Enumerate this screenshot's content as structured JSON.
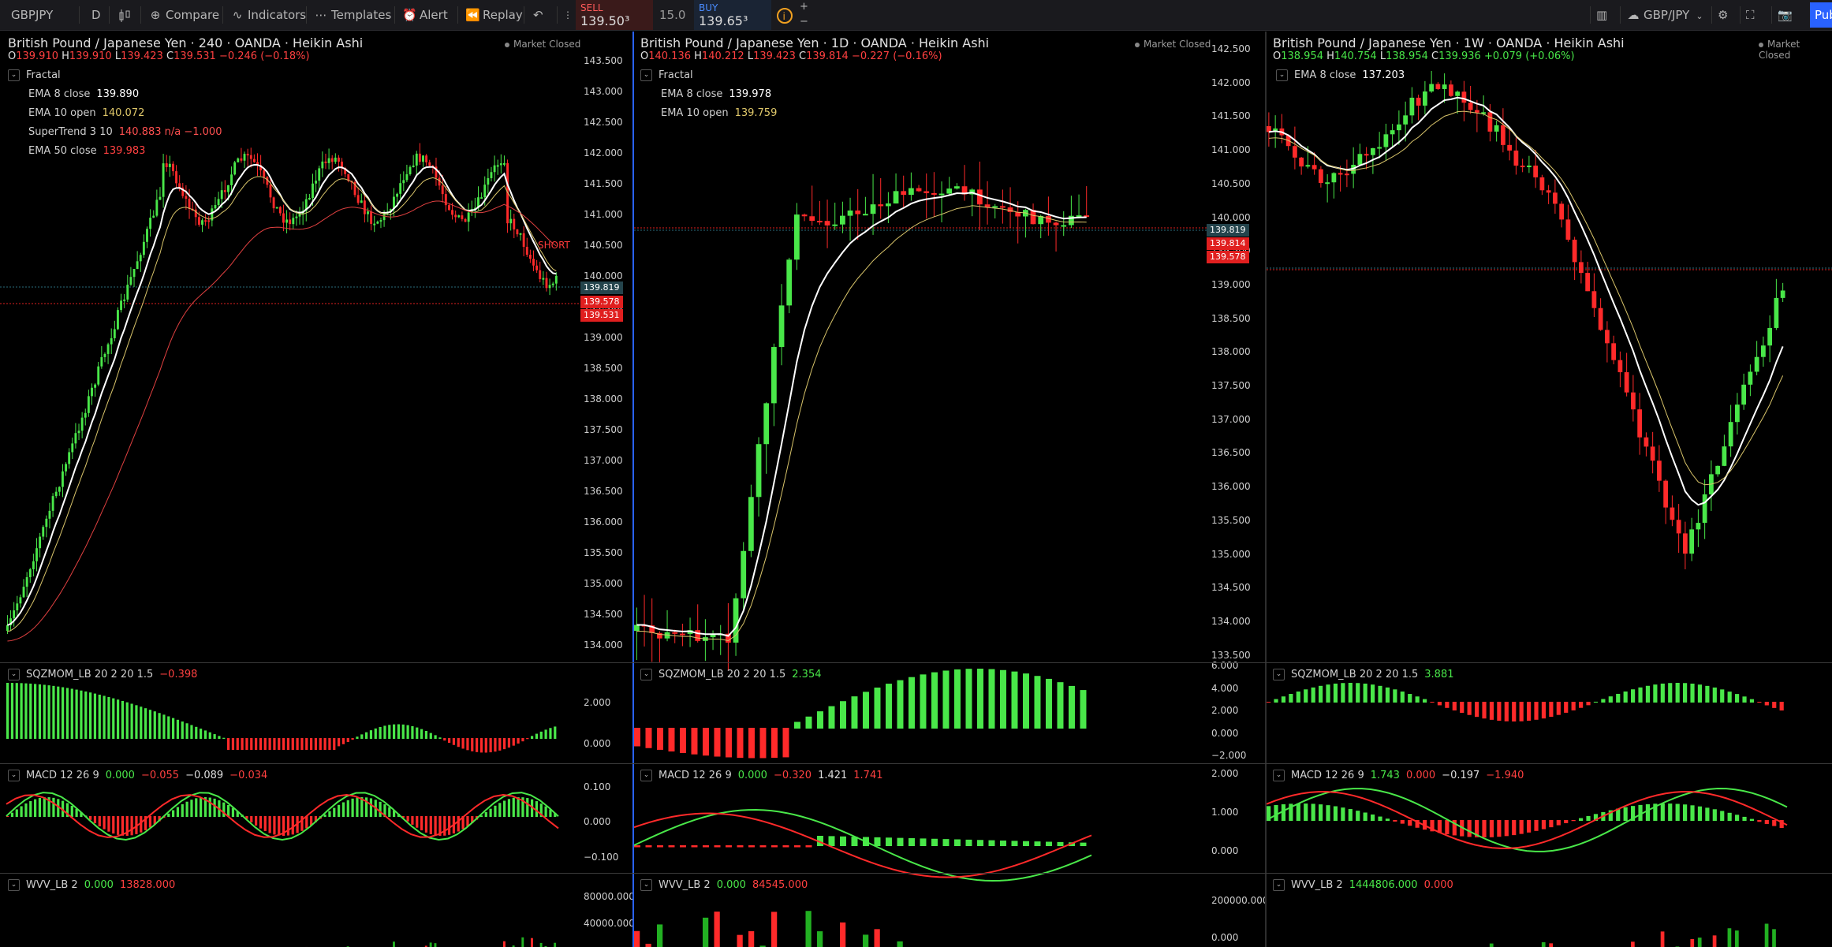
{
  "toolbar": {
    "symbol": "GBPJPY",
    "interval": "D",
    "compare": "Compare",
    "indicators": "Indicators",
    "templates": "Templates",
    "alert": "Alert",
    "replay": "Replay",
    "sell_label": "SELL",
    "sell_price": "139.50³",
    "spread": "15.0",
    "buy_label": "BUY",
    "buy_price": "139.65³",
    "pair_dropdown": "GBP/JPY",
    "publish": "Publish"
  },
  "colors": {
    "up": "#49e749",
    "down": "#ff2a2a",
    "ema8": "#ffffff",
    "ema10": "#d8c46a",
    "ema50": "#e04040",
    "supertrend": "#49c449",
    "accent": "#2962ff"
  },
  "market_status": "Market Closed",
  "panels": [
    {
      "title": "British Pound / Japanese Yen · 240 · OANDA · Heikin Ashi",
      "ohlc": {
        "o": "139.910",
        "h": "139.910",
        "l": "139.423",
        "c": "139.531",
        "chg": "−0.246 (−0.18%)"
      },
      "indicators": [
        {
          "name": "Fractal",
          "value": ""
        },
        {
          "name": "EMA 8 close",
          "value": "139.890"
        },
        {
          "name": "EMA 10 open",
          "value": "140.072"
        },
        {
          "name": "SuperTrend 3 10",
          "value": "140.883  n/a  −1.000"
        },
        {
          "name": "EMA 50 close",
          "value": "139.983"
        }
      ],
      "annotation": "SHORT",
      "price_axis": [
        "143.500",
        "143.000",
        "142.500",
        "142.000",
        "141.500",
        "141.000",
        "140.500",
        "140.000",
        "139.500",
        "139.000",
        "138.500",
        "138.000",
        "137.500",
        "137.000",
        "136.500",
        "136.000",
        "135.500",
        "135.000",
        "134.500",
        "134.000"
      ],
      "price_tags": [
        "139.819",
        "139.578",
        "139.531"
      ],
      "sqz": {
        "label": "SQZMOM_LB 20 2 20 1.5",
        "value": "−0.398",
        "axis": [
          "2.000",
          "0.000"
        ]
      },
      "macd": {
        "label": "MACD 12 26 9",
        "values": [
          "0.000",
          "−0.055",
          "−0.089",
          "−0.034"
        ],
        "axis": [
          "0.100",
          "0.000",
          "−0.100"
        ]
      },
      "wvf": {
        "label": "WVV_LB 2",
        "values": [
          "0.000",
          "13828.000"
        ],
        "axis": [
          "80000.000",
          "40000.000"
        ]
      }
    },
    {
      "title": "British Pound / Japanese Yen · 1D · OANDA · Heikin Ashi",
      "ohlc": {
        "o": "140.136",
        "h": "140.212",
        "l": "139.423",
        "c": "139.814",
        "chg": "−0.227 (−0.16%)"
      },
      "indicators": [
        {
          "name": "Fractal",
          "value": ""
        },
        {
          "name": "EMA 8 close",
          "value": "139.978"
        },
        {
          "name": "EMA 10 open",
          "value": "139.759"
        }
      ],
      "price_axis": [
        "142.500",
        "142.000",
        "141.500",
        "141.000",
        "140.500",
        "140.000",
        "139.500",
        "139.000",
        "138.500",
        "138.000",
        "137.500",
        "137.000",
        "136.500",
        "136.000",
        "135.500",
        "135.000",
        "134.500",
        "134.000",
        "133.500"
      ],
      "price_tags": [
        "139.819",
        "139.814",
        "139.578"
      ],
      "sqz": {
        "label": "SQZMOM_LB 20 2 20 1.5",
        "value": "2.354",
        "axis": [
          "6.000",
          "4.000",
          "2.000",
          "0.000",
          "−2.000"
        ]
      },
      "macd": {
        "label": "MACD 12 26 9",
        "values": [
          "0.000",
          "−0.320",
          "1.421",
          "1.741"
        ],
        "axis": [
          "2.000",
          "1.000",
          "0.000"
        ]
      },
      "wvf": {
        "label": "WVV_LB 2",
        "values": [
          "0.000",
          "84545.000"
        ],
        "axis": [
          "200000.000",
          "0.000"
        ]
      }
    },
    {
      "title": "British Pound / Japanese Yen · 1W · OANDA · Heikin Ashi",
      "ohlc": {
        "o": "138.954",
        "h": "140.754",
        "l": "138.954",
        "c": "139.936",
        "chg": "+0.079 (+0.06%)"
      },
      "indicators": [
        {
          "name": "EMA 8 close",
          "value": "137.203"
        }
      ],
      "sqz": {
        "label": "SQZMOM_LB 20 2 20 1.5",
        "value": "3.881"
      },
      "macd": {
        "label": "MACD 12 26 9",
        "values": [
          "1.743",
          "0.000",
          "−0.197",
          "−1.940"
        ]
      },
      "wvf": {
        "label": "WVV_LB 2",
        "values": [
          "1444806.000",
          "0.000"
        ]
      }
    }
  ]
}
